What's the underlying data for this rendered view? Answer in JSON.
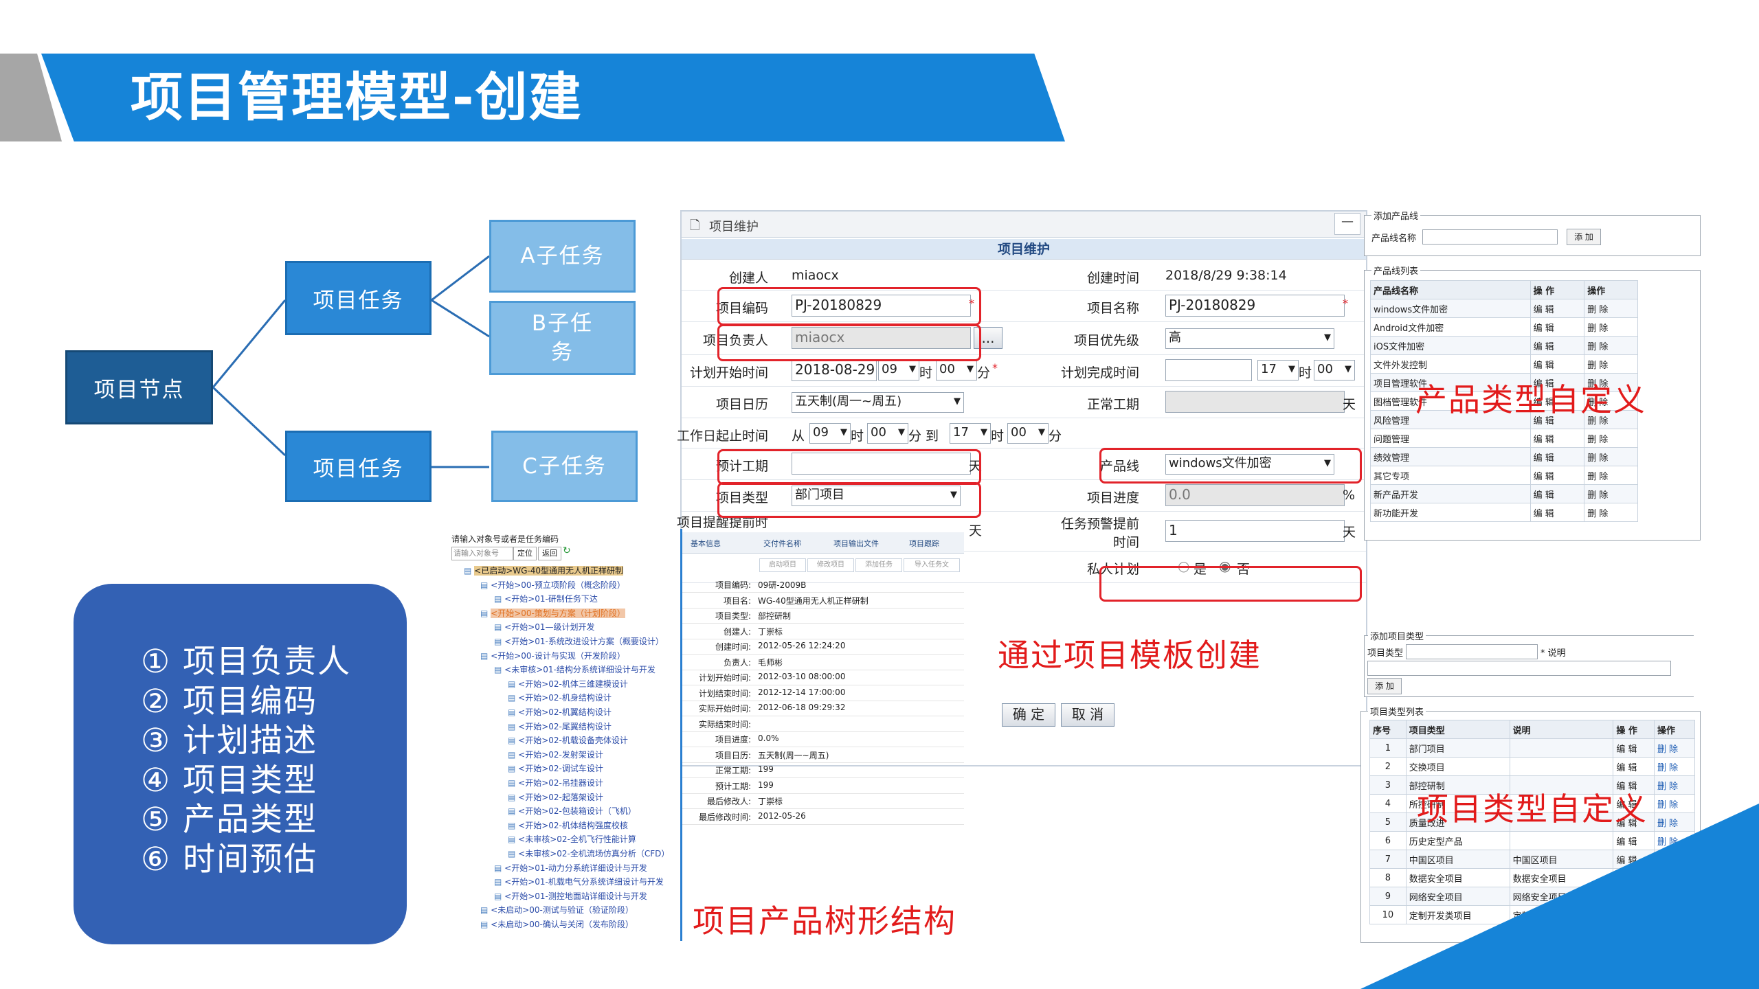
{
  "title": "项目管理模型-创建",
  "diagram": {
    "root": "项目节点",
    "mid": [
      "项目任务",
      "项目任务"
    ],
    "leaves": [
      "A子任务",
      "B子任务",
      "C子任务"
    ]
  },
  "feature_list": [
    "① 项目负责人",
    "② 项目编码",
    "③ 计划描述",
    "④ 项目类型",
    "⑤ 产品类型",
    "⑥ 时间预估"
  ],
  "captions": {
    "tree": "项目产品树形结构",
    "template": "通过项目模板创建",
    "product_custom": "产品类型自定义",
    "project_type_custom": "项目类型自定义"
  },
  "form": {
    "window_title": "项目维护",
    "section_title": "项目维护",
    "creator_label": "创建人",
    "creator": "miaocx",
    "created_time_label": "创建时间",
    "created_time": "2018/8/29 9:38:14",
    "code_label": "项目编码",
    "code": "PJ-20180829",
    "name_label": "项目名称",
    "name": "PJ-20180829",
    "owner_label": "项目负责人",
    "owner": "miaocx",
    "owner_btn": "...",
    "priority_label": "项目优先级",
    "priority": "高",
    "plan_start_label": "计划开始时间",
    "plan_start_date": "2018-08-29",
    "plan_start_hour": "09",
    "plan_start_min": "00",
    "hour_unit": "时",
    "min_unit": "分",
    "plan_end_label": "计划完成时间",
    "plan_end_hour": "17",
    "plan_end_min": "00",
    "calendar_label": "项目日历",
    "calendar": "五天制(周一~周五)",
    "normal_days_label": "正常工期",
    "day_unit": "天",
    "workday_label": "工作日起止时间",
    "from": "从",
    "wd_h1": "09",
    "wd_m1": "00",
    "to": "分 到",
    "wd_h2": "17",
    "wd_m2": "00",
    "est_days_label": "预计工期",
    "product_line_label": "产品线",
    "product_line": "windows文件加密",
    "type_label": "项目类型",
    "type": "部门项目",
    "progress_label": "项目进度",
    "progress": "0.0",
    "percent": "%",
    "remind_label": "项目提醒提前时",
    "task_remind_label": "任务预警提前时间",
    "task_remind": "1",
    "private_label": "私人计划",
    "yes": "是",
    "no": "否",
    "ok": "确 定",
    "cancel": "取 消"
  },
  "tree_shot": {
    "search_hint": "请输入对象号或者是任务编码",
    "search_placeholder": "请输入对象号",
    "btn_locate": "定位",
    "btn_back": "返回",
    "nodes": [
      "<已启动>WG-40型通用无人机正样研制",
      "<开始>00-预立项阶段（概念阶段）",
      "<开始>01-研制任务下达",
      "<开始>00-策划与方案（计划阶段）",
      "<开始>01—级计划开发",
      "<开始>01-系统改进设计方案（概要设计）",
      "<开始>00-设计与实现（开发阶段）",
      "<未审核>01-结构分系统详细设计与开发",
      "<开始>02-机体三维建模设计",
      "<开始>02-机身结构设计",
      "<开始>02-机翼结构设计",
      "<开始>02-尾翼结构设计",
      "<开始>02-机载设备壳体设计",
      "<开始>02-发射架设计",
      "<开始>02-调试车设计",
      "<开始>02-吊挂器设计",
      "<开始>02-起落架设计",
      "<开始>02-包装箱设计（飞机）",
      "<开始>02-机体结构强度校核",
      "<未审核>02-全机飞行性能计算",
      "<未审核>02-全机流场仿真分析（CFD）",
      "<开始>01-动力分系统详细设计与开发",
      "<开始>01-机载电气分系统详细设计与开发",
      "<开始>01-测控地面站详细设计与开发",
      "<未启动>00-测试与验证（验证阶段）",
      "<未启动>00-确认与关闭（发布阶段）"
    ],
    "tabs": [
      "基本信息",
      "交付件名称",
      "项目输出文件",
      "项目跟踪"
    ],
    "actions": [
      "启动项目",
      "修改项目",
      "添加任务",
      "导入任务文"
    ],
    "details": [
      [
        "项目编码:",
        "09研-2009B"
      ],
      [
        "项目名:",
        "WG-40型通用无人机正样研制"
      ],
      [
        "项目类型:",
        "部控研制"
      ],
      [
        "创建人:",
        "丁崇标"
      ],
      [
        "创建时间:",
        "2012-05-26 12:24:20"
      ],
      [
        "负责人:",
        "毛师彬"
      ],
      [
        "计划开始时间:",
        "2012-03-10 08:00:00"
      ],
      [
        "计划结束时间:",
        "2012-12-14 17:00:00"
      ],
      [
        "实际开始时间:",
        "2012-06-18 09:29:32"
      ],
      [
        "实际结束时间:",
        ""
      ],
      [
        "项目进度:",
        "0.0%"
      ],
      [
        "项目日历:",
        "五天制(周一~周五)"
      ],
      [
        "正常工期:",
        "199"
      ],
      [
        "预计工期:",
        "199"
      ],
      [
        "最后修改人:",
        "丁崇标"
      ],
      [
        "最后修改时间:",
        "2012-05-26"
      ]
    ]
  },
  "product_panel": {
    "add_legend": "添加产品线",
    "name_label": "产品线名称",
    "add_btn": "添 加",
    "list_legend": "产品线列表",
    "headers": [
      "产品线名称",
      "操 作",
      "操作"
    ],
    "edit": "编 辑",
    "delete": "删 除",
    "rows": [
      "windows文件加密",
      "Android文件加密",
      "iOS文件加密",
      "文件外发控制",
      "项目管理软件",
      "图档管理软件",
      "风险管理",
      "问题管理",
      "绩效管理",
      "其它专项",
      "新产品开发",
      "新功能开发"
    ]
  },
  "type_panel": {
    "add_legend": "添加项目类型",
    "type_label": "项目类型",
    "note_label": "* 说明",
    "add_btn": "添 加",
    "list_legend": "项目类型列表",
    "headers": [
      "序号",
      "项目类型",
      "说明",
      "操 作",
      "操作"
    ],
    "edit": "编 辑",
    "delete": "删 除",
    "rows": [
      [
        "1",
        "部门项目",
        ""
      ],
      [
        "2",
        "交换项目",
        ""
      ],
      [
        "3",
        "部控研制",
        ""
      ],
      [
        "4",
        "所控研制",
        ""
      ],
      [
        "5",
        "质量改进",
        ""
      ],
      [
        "6",
        "历史定型产品",
        ""
      ],
      [
        "7",
        "中国区项目",
        "中国区项目"
      ],
      [
        "8",
        "数据安全项目",
        "数据安全项目"
      ],
      [
        "9",
        "网络安全项目",
        "网络安全项目"
      ],
      [
        "10",
        "定制开发类项目",
        "定制开发类项目"
      ]
    ]
  }
}
